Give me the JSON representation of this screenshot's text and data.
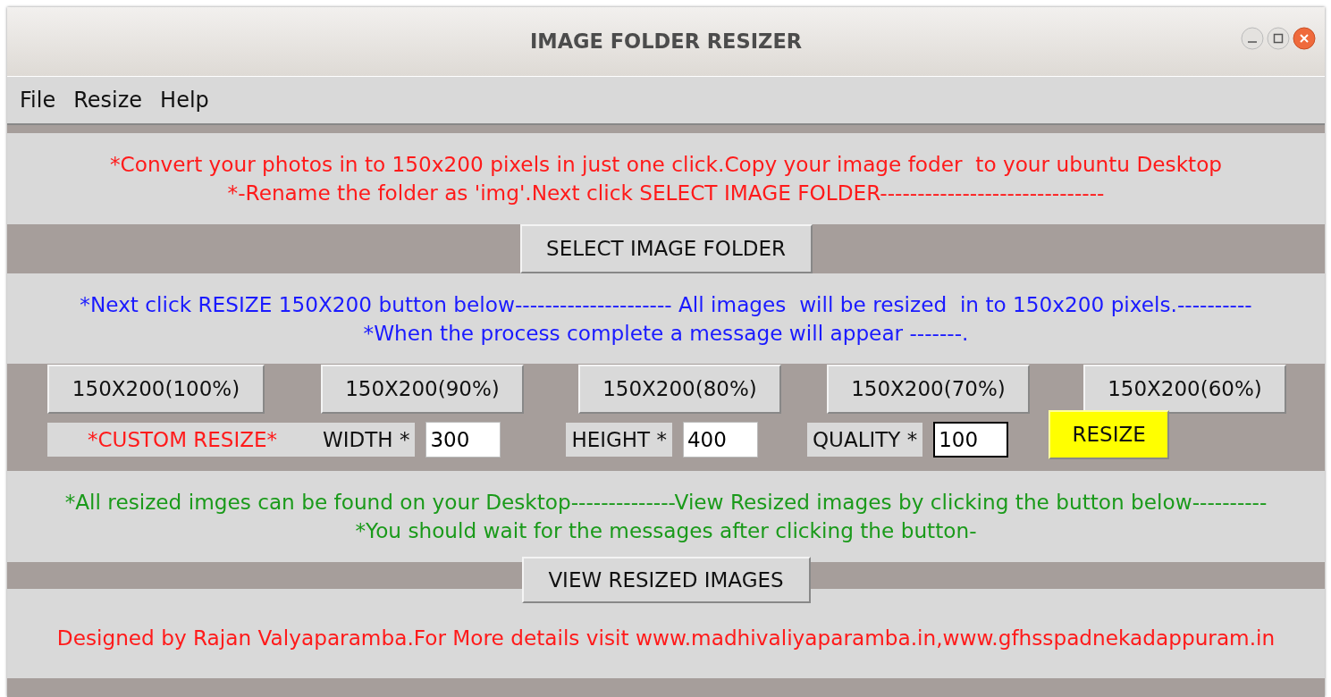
{
  "window": {
    "title": "IMAGE FOLDER RESIZER"
  },
  "menu": [
    "File",
    "Resize",
    "Help"
  ],
  "intro": [
    "*Convert your photos in to 150x200 pixels in just one click.Copy your image foder  to your ubuntu Desktop",
    "*-Rename the folder as 'img'.Next click SELECT IMAGE FOLDER------------------------------"
  ],
  "select_button": "SELECT IMAGE FOLDER",
  "instructions": [
    "*Next click RESIZE 150X200 button below--------------------- All images  will be resized  in to 150x200 pixels.----------",
    "*When the process complete a message will appear -------."
  ],
  "presets": [
    "150X200(100%)",
    "150X200(90%)",
    "150X200(80%)",
    "150X200(70%)",
    "150X200(60%)"
  ],
  "custom": {
    "title": "*CUSTOM RESIZE*",
    "fields": [
      {
        "label": "WIDTH *",
        "value": "300",
        "focused": false
      },
      {
        "label": "HEIGHT *",
        "value": "400",
        "focused": false
      },
      {
        "label": "QUALITY *",
        "value": "100",
        "focused": true
      }
    ],
    "button": "RESIZE"
  },
  "results": [
    "*All resized imges can be found on your Desktop--------------View Resized images by clicking the button below----------",
    "*You should wait for the messages after clicking the button-"
  ],
  "view_button": "VIEW RESIZED IMAGES",
  "footer": "Designed by Rajan Valyaparamba.For More details visit www.madhivaliyaparamba.in,www.gfhsspadnekadappuram.in"
}
